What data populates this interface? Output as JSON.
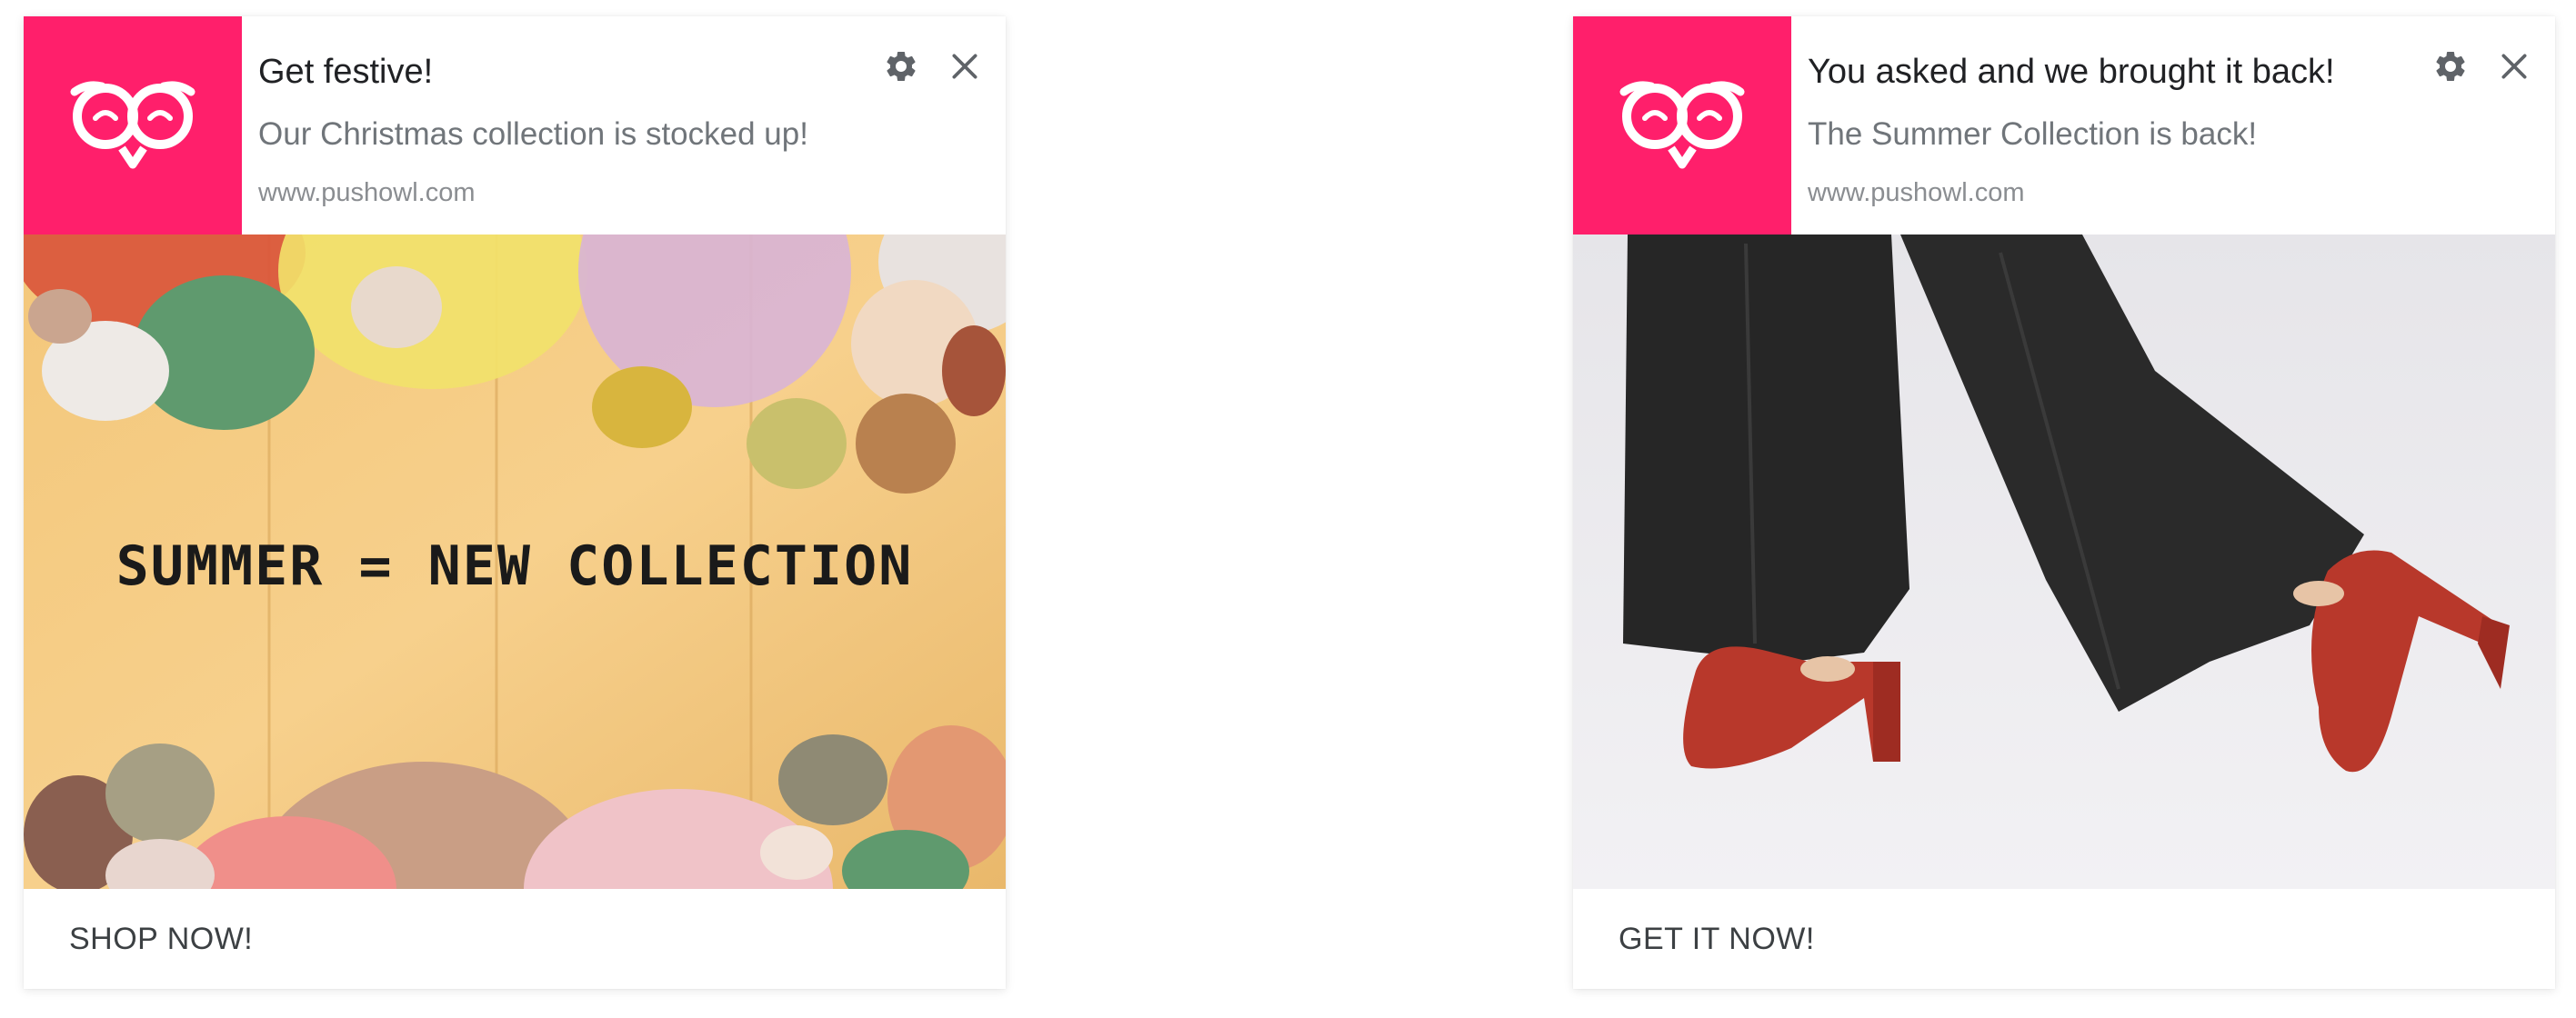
{
  "notifications": [
    {
      "title": "Get festive!",
      "message": "Our Christmas collection is stocked up!",
      "site": "www.pushowl.com",
      "image_text": "SUMMER = NEW COLLECTION",
      "action_label": "SHOP NOW!",
      "logo_icon": "owl-logo-icon",
      "image_subject": "seashells on wooden planks"
    },
    {
      "title": "You asked and we brought it back!",
      "message": "The Summer Collection is back!",
      "site": "www.pushowl.com",
      "action_label": "GET IT NOW!",
      "logo_icon": "owl-logo-icon",
      "image_subject": "wide-leg black trousers with red heels"
    }
  ],
  "colors": {
    "brand_pink": "#ff1f6b",
    "icon_gray": "#5f6368"
  }
}
